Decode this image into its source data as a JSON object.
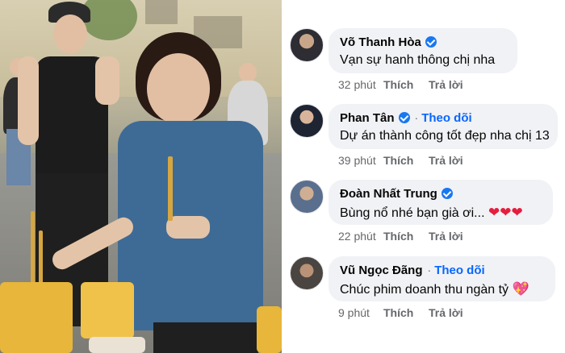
{
  "comments": [
    {
      "name": "Võ Thanh Hòa",
      "verified": true,
      "follow": "",
      "text": "Vạn sự hanh thông chị nha",
      "time": "32 phút",
      "like": "Thích",
      "reply": "Trả lời"
    },
    {
      "name": "Phan Tân",
      "verified": true,
      "follow": "Theo dõi",
      "separator": "·",
      "text": "Dự án thành công tốt đẹp nha chị 13",
      "time": "39 phút",
      "like": "Thích",
      "reply": "Trả lời"
    },
    {
      "name": "Đoàn Nhất Trung",
      "verified": true,
      "follow": "",
      "text": "Bùng nổ nhé bạn già ơi...",
      "emoji": "❤❤❤",
      "time": "22 phút",
      "like": "Thích",
      "reply": "Trả lời"
    },
    {
      "name": "Vũ Ngọc Đãng",
      "verified": false,
      "follow": "Theo dõi",
      "separator": "·",
      "text": "Chúc phim doanh thu ngàn tỷ",
      "emoji": "💖",
      "time": "9 phút",
      "like": "Thích",
      "reply": "Trả lời"
    }
  ],
  "colors": {
    "bubble": "#f0f2f5",
    "link_blue": "#0866ff",
    "verified_blue": "#1877f2",
    "meta_gray": "#65676b",
    "heart_red": "#e41e3f"
  },
  "icons": [
    "verified-badge-icon",
    "red-heart-emoji",
    "sparkling-heart-emoji"
  ]
}
